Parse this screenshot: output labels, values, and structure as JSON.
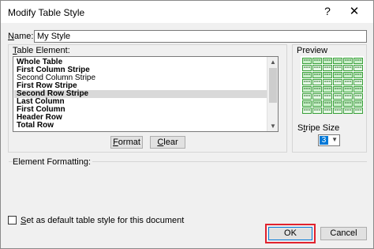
{
  "window": {
    "title": "Modify Table Style",
    "help_glyph": "?",
    "close_glyph": "✕"
  },
  "name_field": {
    "label_prefix": "",
    "label_underlined": "N",
    "label_suffix": "ame:",
    "value": "My Style"
  },
  "table_element": {
    "label_underlined": "T",
    "label_suffix": "able Element:",
    "items": [
      {
        "label": "Whole Table",
        "bold": true,
        "selected": false
      },
      {
        "label": "First Column Stripe",
        "bold": true,
        "selected": false
      },
      {
        "label": "Second Column Stripe",
        "bold": false,
        "selected": false
      },
      {
        "label": "First Row Stripe",
        "bold": true,
        "selected": false
      },
      {
        "label": "Second Row Stripe",
        "bold": true,
        "selected": true
      },
      {
        "label": "Last Column",
        "bold": true,
        "selected": false
      },
      {
        "label": "First Column",
        "bold": true,
        "selected": false
      },
      {
        "label": "Header Row",
        "bold": true,
        "selected": false
      },
      {
        "label": "Total Row",
        "bold": true,
        "selected": false
      }
    ]
  },
  "buttons": {
    "format_underlined": "F",
    "format_suffix": "ormat",
    "clear_underlined": "C",
    "clear_suffix": "lear",
    "ok": "OK",
    "cancel": "Cancel"
  },
  "preview": {
    "label": "Preview",
    "cell_glyph": "==="
  },
  "stripe_size": {
    "label_prefix": "S",
    "label_underlined": "t",
    "label_suffix": "ripe Size",
    "value": "3"
  },
  "element_formatting": {
    "label": "Element Formatting:"
  },
  "default_checkbox": {
    "label_underlined": "S",
    "label_suffix": "et as default table style for this document",
    "checked": false
  },
  "colors": {
    "highlight": "#e0222e",
    "preview_cell": "#c9f0c9",
    "preview_border": "#3aa03a",
    "selection": "#d9d9d9",
    "stripe_value_bg": "#0078d7"
  }
}
